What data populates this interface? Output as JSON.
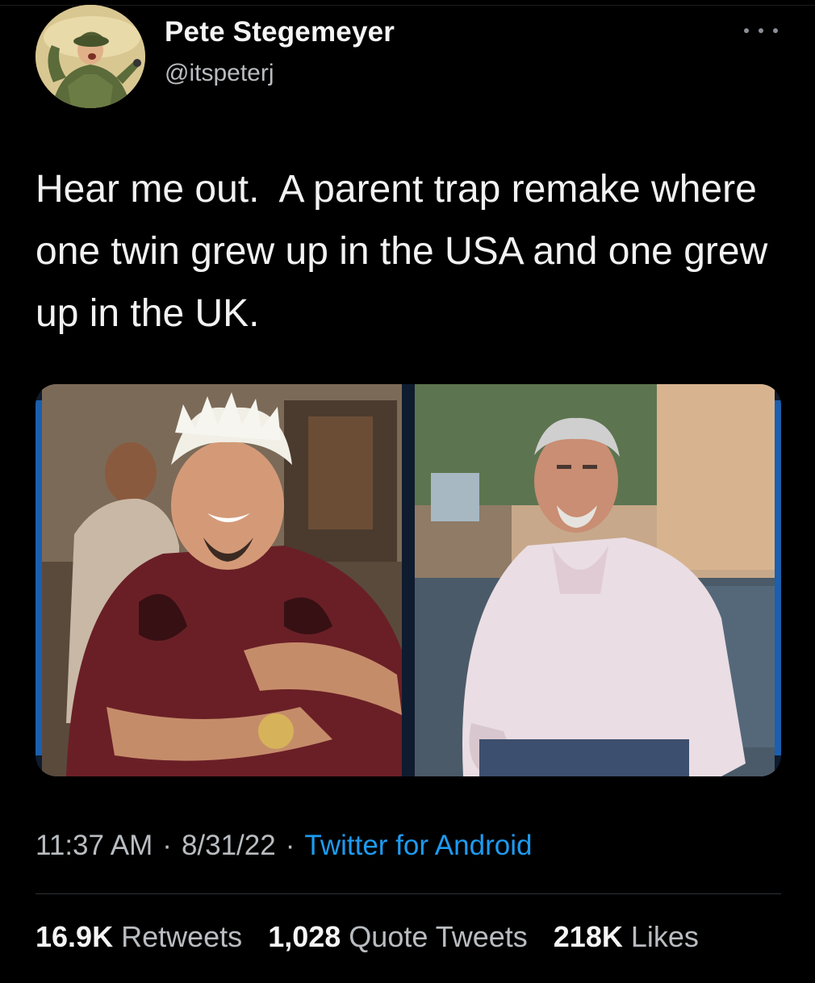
{
  "user": {
    "display_name": "Pete Stegemeyer",
    "handle": "@itspeterj"
  },
  "tweet": {
    "text": "Hear me out.  A parent trap remake where one twin grew up in the USA and one grew up in the UK."
  },
  "meta": {
    "time": "11:37 AM",
    "date": "8/31/22",
    "separator": "·",
    "source": "Twitter for Android"
  },
  "stats": {
    "retweets_count": "16.9K",
    "retweets_label": "Retweets",
    "quotes_count": "1,028",
    "quotes_label": "Quote Tweets",
    "likes_count": "218K",
    "likes_label": "Likes"
  },
  "colors": {
    "background": "#000000",
    "link": "#1d9bf0",
    "secondary_text": "#b9bdc1"
  },
  "icons": {
    "more": "more-dots-icon"
  }
}
